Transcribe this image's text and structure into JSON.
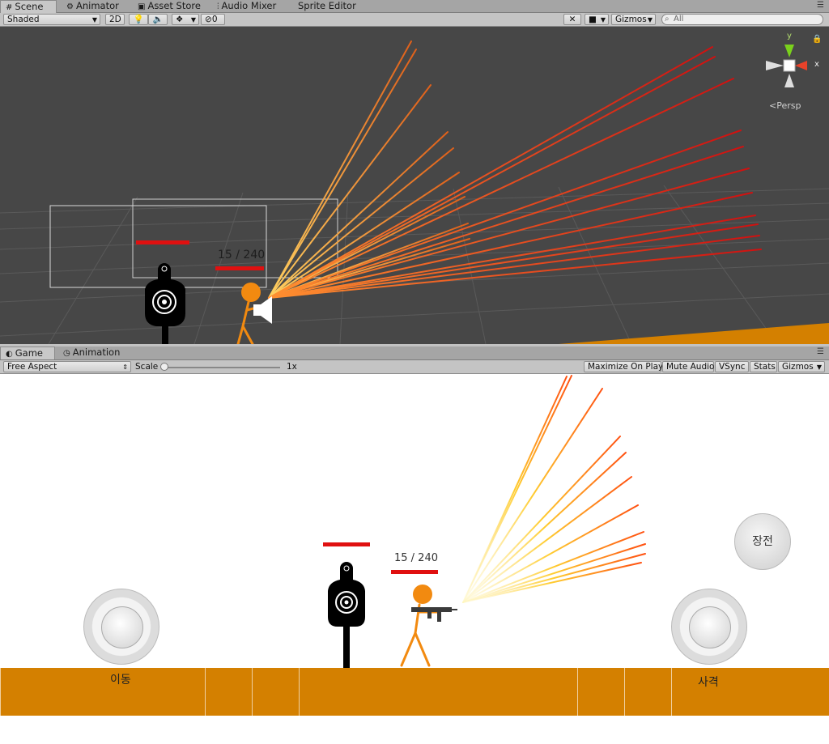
{
  "scene_tabs": [
    {
      "label": "Scene",
      "icon": "scene-icon"
    },
    {
      "label": "Animator",
      "icon": "animator-icon"
    },
    {
      "label": "Asset Store",
      "icon": "store-icon"
    },
    {
      "label": "Audio Mixer",
      "icon": "mixer-icon"
    },
    {
      "label": "Sprite Editor",
      "icon": ""
    }
  ],
  "scene_toolbar": {
    "shading": "Shaded",
    "mode_2d": "2D",
    "layer_count": "0",
    "gizmos": "Gizmos",
    "search_placeholder": "All"
  },
  "scene_view": {
    "ammo_text": "15 / 240",
    "gizmo_y": "y",
    "gizmo_x": "x",
    "persp": "Persp"
  },
  "game_tabs": [
    {
      "label": "Game",
      "icon": "game-icon"
    },
    {
      "label": "Animation",
      "icon": "animation-icon"
    }
  ],
  "game_toolbar": {
    "aspect": "Free Aspect",
    "scale_label": "Scale",
    "scale_value": "1x",
    "maximize": "Maximize On Play",
    "mute": "Mute Audio",
    "vsync": "VSync",
    "stats": "Stats",
    "gizmos": "Gizmos"
  },
  "game_view": {
    "ammo_text": "15 / 240",
    "reload_label": "장전",
    "move_label": "이동",
    "fire_label": "사격"
  },
  "colors": {
    "ground": "#d48000",
    "health_bar": "#e01010",
    "stickman": "#f28a10",
    "scene_bg": "#474747"
  }
}
